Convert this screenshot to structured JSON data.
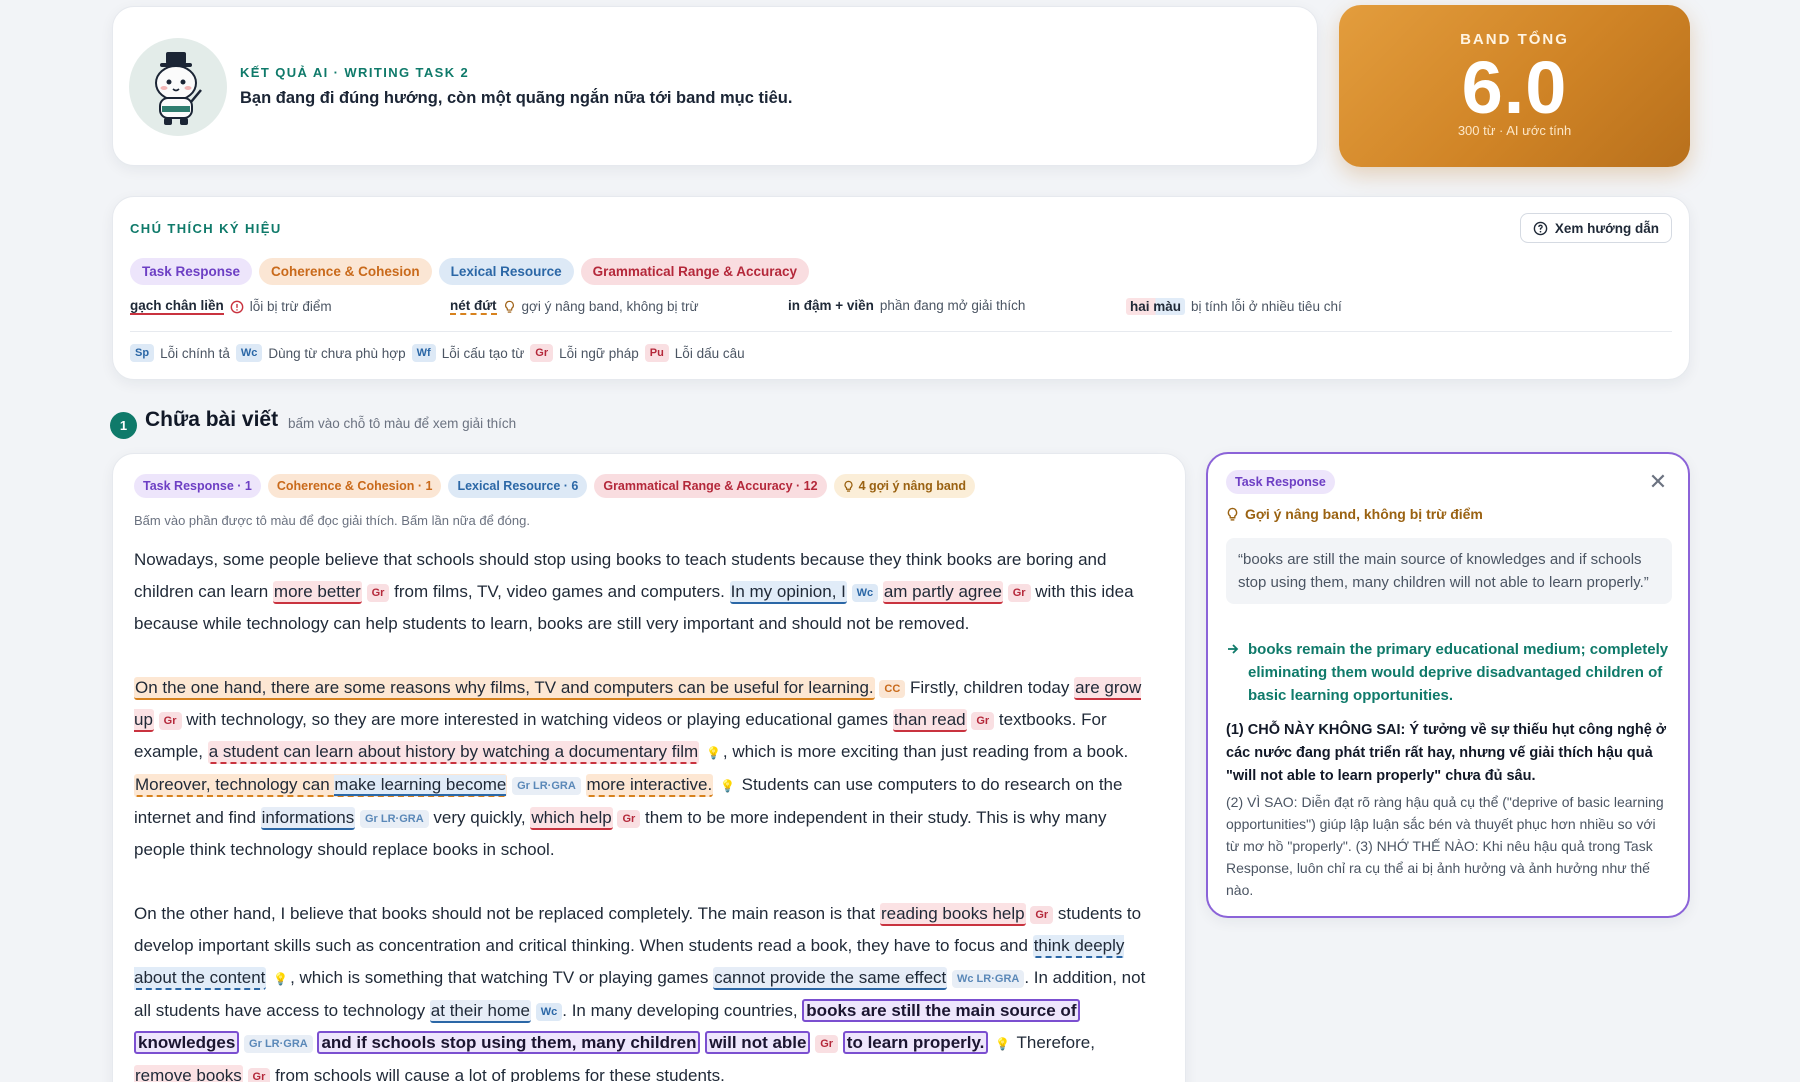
{
  "hero": {
    "kicker": "KẾT QUẢ AI · WRITING TASK 2",
    "subtitle": "Bạn đang đi đúng hướng, còn một quãng ngắn nữa tới band mục tiêu."
  },
  "band": {
    "label": "BAND TỔNG",
    "score": "6.0",
    "note": "300 từ · AI ước tính"
  },
  "legend": {
    "title": "CHÚ THÍCH KÝ HIỆU",
    "guide_button": "Xem hướng dẫn",
    "criteria": [
      "Task Response",
      "Coherence & Cohesion",
      "Lexical Resource",
      "Grammatical Range & Accuracy"
    ],
    "keys": [
      {
        "term": "gạch chân liền",
        "desc": "lỗi bị trừ điểm"
      },
      {
        "term": "nét đứt",
        "desc": "gợi ý nâng band, không bị trừ"
      },
      {
        "term": "in đậm + viền",
        "desc": "phần đang mở giải thích"
      },
      {
        "term": "hai màu",
        "desc": "bị tính lỗi ở nhiều tiêu chí"
      }
    ],
    "codes": [
      {
        "code": "Sp",
        "desc": "Lỗi chính tả"
      },
      {
        "code": "Wc",
        "desc": "Dùng từ chưa phù hợp"
      },
      {
        "code": "Wf",
        "desc": "Lỗi cấu tạo từ"
      },
      {
        "code": "Gr",
        "desc": "Lỗi ngữ pháp"
      },
      {
        "code": "Pu",
        "desc": "Lỗi dấu câu"
      }
    ]
  },
  "section": {
    "number": "1",
    "title": "Chữa bài viết",
    "hint": "bấm vào chỗ tô màu để xem giải thích"
  },
  "essay": {
    "counts": [
      "Task Response · 1",
      "Coherence & Cohesion · 1",
      "Lexical Resource · 6",
      "Grammatical Range & Accuracy · 12",
      "4 gợi ý nâng band"
    ],
    "hint": "Bấm vào phần được tô màu để đọc giải thích. Bấm lần nữa để đóng."
  },
  "panel": {
    "criterion": "Task Response",
    "tip": "Gợi ý nâng band, không bị trừ điểm",
    "quote": "“books are still the main source of knowledges and if schools stop using them, many children will not able to learn properly.”",
    "rewrite": "books remain the primary educational medium; completely eliminating them would deprive disadvantaged children of basic learning opportunities.",
    "explanation": "(1) CHỖ NÀY KHÔNG SAI: Ý tưởng về sự thiếu hụt công nghệ ở các nước đang phát triển rất hay, nhưng vế giải thích hậu quả \"will not able to learn properly\" chưa đủ sâu.",
    "details": "(2) VÌ SAO: Diễn đạt rõ ràng hậu quả cụ thể (\"deprive of basic learning opportunities\") giúp lập luận sắc bén và thuyết phục hơn nhiều so với từ mơ hồ \"properly\". (3) NHỚ THẾ NÀO: Khi nêu hậu quả trong Task Response, luôn chỉ ra cụ thể ai bị ảnh hưởng và ảnh hưởng như thế nào."
  },
  "colors": {
    "teal": "#0f7a6a",
    "band_orange": "#d08426",
    "task_response": "#6d3fc4",
    "coherence": "#c96a1b",
    "lexical": "#2b67a6",
    "grammar": "#b4283a"
  },
  "icons": [
    "mascot-avatar",
    "help-circle-icon",
    "alert-circle-icon",
    "lightbulb-icon",
    "close-icon",
    "arrow-right-icon"
  ]
}
